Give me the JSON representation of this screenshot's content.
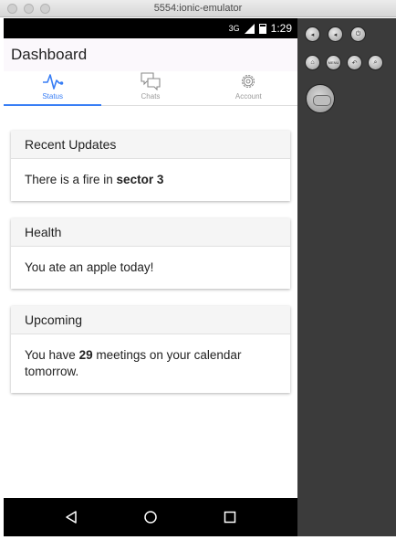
{
  "window": {
    "title": "5554:ionic-emulator"
  },
  "statusbar": {
    "network": "3G",
    "time": "1:29"
  },
  "header": {
    "title": "Dashboard"
  },
  "tabs": [
    {
      "label": "Status",
      "icon": "pulse-icon",
      "active": true
    },
    {
      "label": "Chats",
      "icon": "chatboxes-icon",
      "active": false
    },
    {
      "label": "Account",
      "icon": "gear-icon",
      "active": false
    }
  ],
  "cards": [
    {
      "header": "Recent Updates",
      "body_pre": "There is a fire in ",
      "body_bold": "sector 3",
      "body_post": ""
    },
    {
      "header": "Health",
      "body_pre": "You ate an apple today!",
      "body_bold": "",
      "body_post": ""
    },
    {
      "header": "Upcoming",
      "body_pre": "You have ",
      "body_bold": "29",
      "body_post": " meetings on your calendar tomorrow."
    }
  ],
  "navbar": {
    "back": "back-icon",
    "home": "home-icon",
    "recents": "recents-icon"
  },
  "emulator_controls": {
    "row1": [
      "volume-down-icon",
      "volume-up-icon",
      "power-icon"
    ],
    "row2": [
      "home-icon",
      "menu-icon",
      "back-icon",
      "search-icon"
    ],
    "menu_text": "MENU"
  },
  "colors": {
    "accent": "#387ef5",
    "header_bg": "#fbf8fc",
    "card_header_bg": "#f5f5f5"
  }
}
